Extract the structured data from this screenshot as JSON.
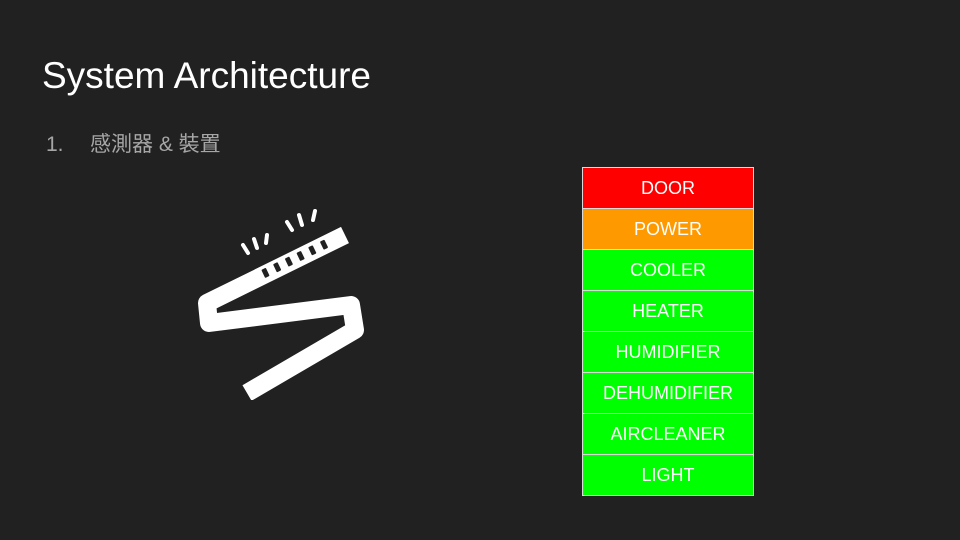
{
  "slide": {
    "title": "System Architecture",
    "bullets": [
      {
        "number": "1.",
        "text": "感測器 & 裝置"
      }
    ]
  },
  "illustration": {
    "icon": "sensor-strip-icon",
    "color": "#ffffff"
  },
  "device_table": {
    "rows": [
      {
        "label": "DOOR",
        "status_color": "#ff0000"
      },
      {
        "label": "POWER",
        "status_color": "#ff9900"
      },
      {
        "label": "COOLER",
        "status_color": "#00ff00"
      },
      {
        "label": "HEATER",
        "status_color": "#00ff00"
      },
      {
        "label": "HUMIDIFIER",
        "status_color": "#00ff00"
      },
      {
        "label": "DEHUMIDIFIER",
        "status_color": "#00ff00"
      },
      {
        "label": "AIRCLEANER",
        "status_color": "#00ff00"
      },
      {
        "label": "LIGHT",
        "status_color": "#00ff00"
      }
    ]
  },
  "theme": {
    "background": "#212121",
    "title_color": "#ffffff",
    "bullet_color": "#a6a6a6"
  }
}
